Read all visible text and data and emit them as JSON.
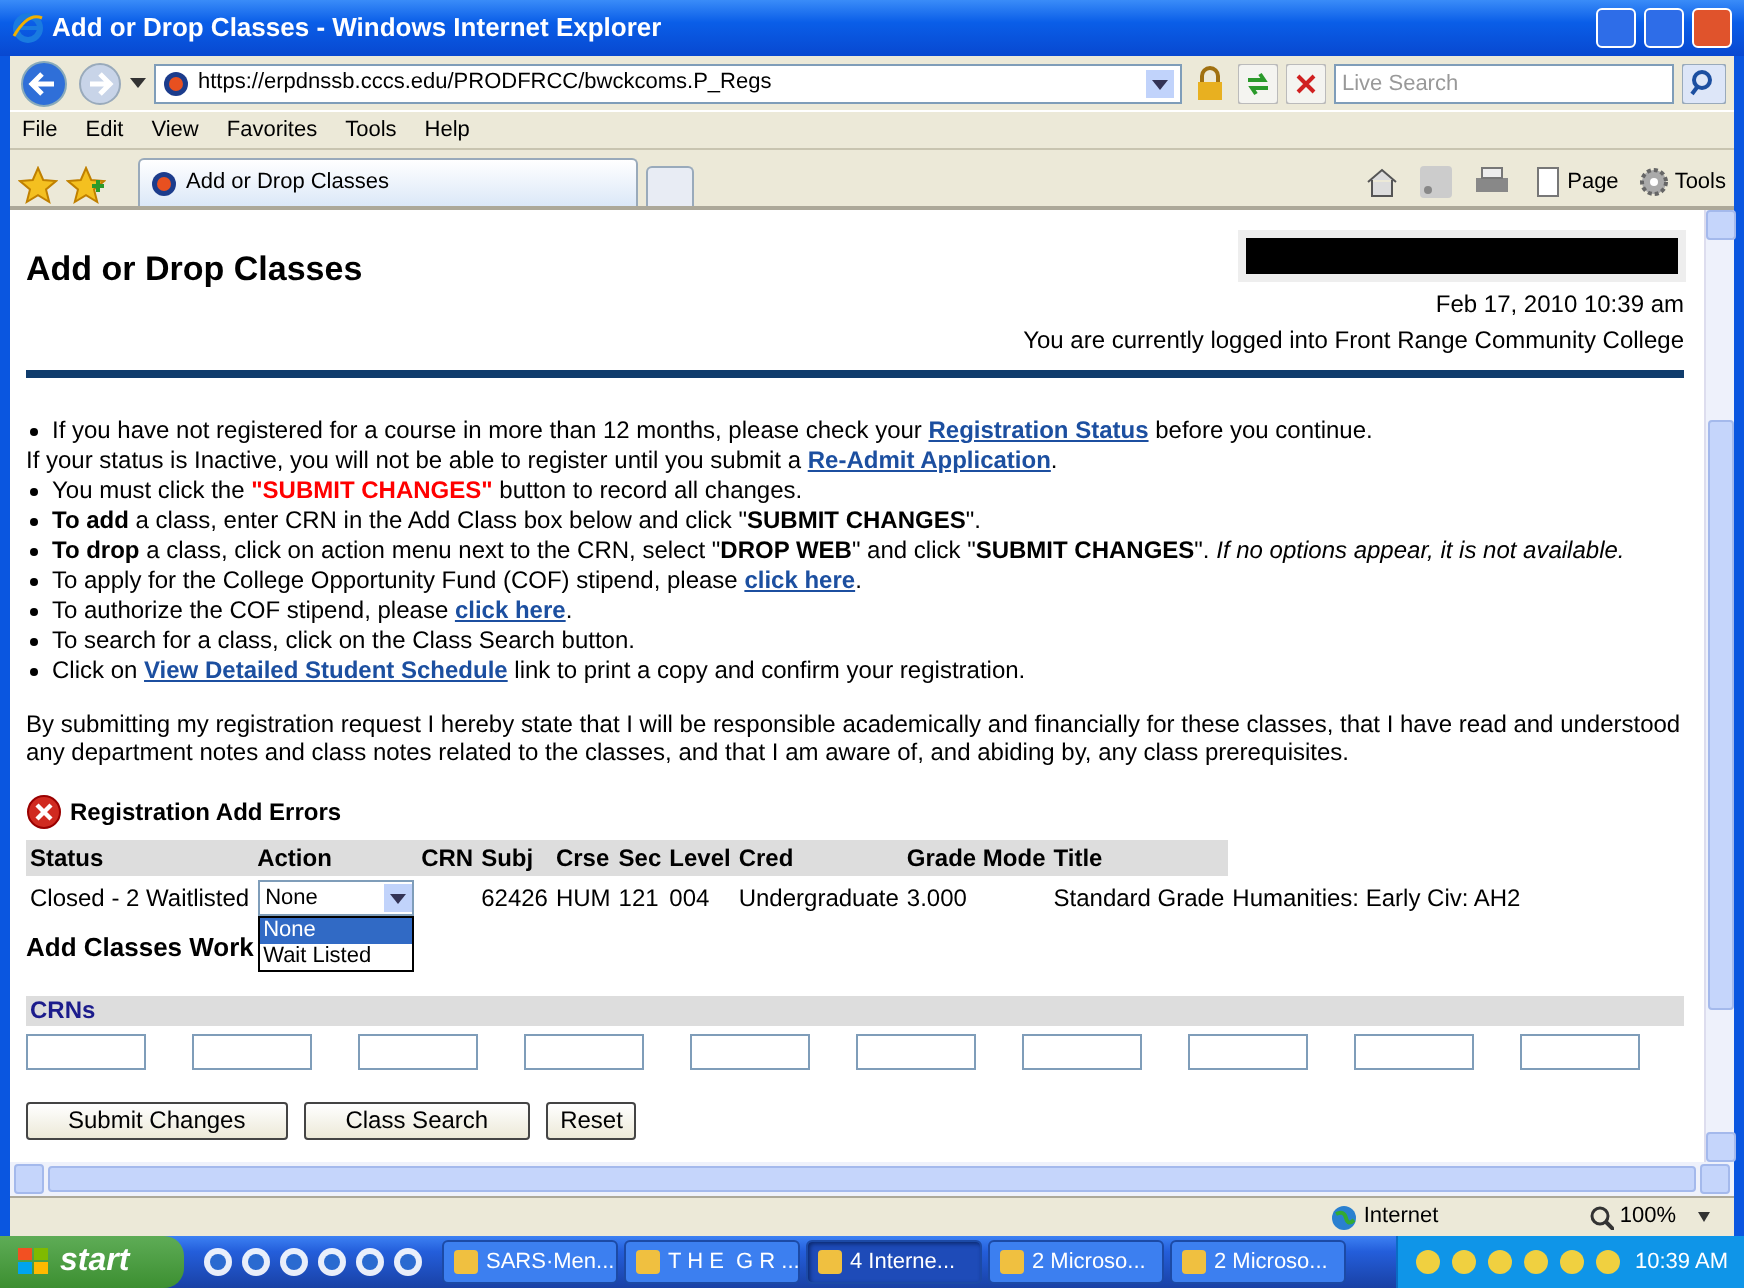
{
  "window": {
    "title": "Add or Drop Classes - Windows Internet Explorer"
  },
  "address_bar": {
    "url": "https://erpdnssb.cccs.edu/PRODFRCC/bwckcoms.P_Regs",
    "search_placeholder": "Live Search"
  },
  "menu": [
    "File",
    "Edit",
    "View",
    "Favorites",
    "Tools",
    "Help"
  ],
  "tab": {
    "label": "Add or Drop Classes"
  },
  "command_bar": [
    "Page",
    "Tools"
  ],
  "page": {
    "title": "Add or Drop Classes",
    "date": "Feb 17, 2010 10:39 am",
    "login": "You are currently logged into Front Range Community College",
    "instructions": [
      {
        "bullet": true,
        "parts": [
          {
            "kind": "text",
            "text": "If you have not registered for a course in more than 12 months, please check your "
          },
          {
            "kind": "link",
            "text": "Registration Status"
          },
          {
            "kind": "text",
            "text": " before you continue."
          }
        ]
      },
      {
        "bullet": false,
        "parts": [
          {
            "kind": "text",
            "text": "If your status is Inactive, you will not be able to register until you submit a "
          },
          {
            "kind": "link",
            "text": "Re-Admit Application"
          },
          {
            "kind": "text",
            "text": "."
          }
        ]
      },
      {
        "bullet": true,
        "parts": [
          {
            "kind": "text",
            "text": "You must click the "
          },
          {
            "kind": "alert",
            "text": "\"SUBMIT CHANGES\""
          },
          {
            "kind": "text",
            "text": " button to record all changes."
          }
        ]
      },
      {
        "bullet": true,
        "parts": [
          {
            "kind": "text",
            "text": "**To add** a class, enter CRN in the Add Class box below and click \"**SUBMIT CHANGES**\"."
          }
        ]
      },
      {
        "bullet": true,
        "parts": [
          {
            "kind": "text",
            "text": "**To drop** a class, click on action menu next to the CRN, select \"**DROP WEB**\" and click \"**SUBMIT CHANGES**\". *If no options appear, it is not available.*"
          }
        ]
      },
      {
        "bullet": true,
        "parts": [
          {
            "kind": "text",
            "text": "To apply for the College Opportunity Fund (COF) stipend, please "
          },
          {
            "kind": "link",
            "text": "click here"
          },
          {
            "kind": "text",
            "text": "."
          }
        ]
      },
      {
        "bullet": true,
        "parts": [
          {
            "kind": "text",
            "text": "To authorize the COF stipend, please "
          },
          {
            "kind": "link",
            "text": "click here"
          },
          {
            "kind": "text",
            "text": "."
          }
        ]
      },
      {
        "bullet": true,
        "parts": [
          {
            "kind": "text",
            "text": "To search for a class, click on the Class Search button."
          }
        ]
      },
      {
        "bullet": true,
        "parts": [
          {
            "kind": "text",
            "text": "Click on "
          },
          {
            "kind": "link",
            "text": "View Detailed Student Schedule"
          },
          {
            "kind": "text",
            "text": " link to print a copy and confirm your registration."
          }
        ]
      }
    ],
    "statement": "By submitting my registration request I hereby state that I will be responsible academically and financially for these classes, that I have read and understood any department notes and class notes related to the classes, and that I am aware of, and abiding by, any class prerequisites.",
    "errors": {
      "title": "Registration Add Errors",
      "columns": [
        "Status",
        "Action",
        "CRN",
        "Subj",
        "Crse",
        "Sec",
        "Level",
        "Cred",
        "Grade Mode",
        "Title"
      ],
      "rows": [
        {
          "status": "Closed - 2 Waitlisted",
          "action": {
            "value": "None",
            "expanded": true,
            "options": [
              {
                "label": "None",
                "selected": true
              },
              {
                "label": "Wait Listed",
                "selected": false
              }
            ]
          },
          "crn": "62426",
          "subj": "HUM",
          "crse": "121",
          "sec": "004",
          "level": "Undergraduate",
          "cred": "3.000",
          "grade_mode": "Standard Grade",
          "title": "Humanities: Early Civ: AH2"
        }
      ]
    },
    "worksheet": {
      "title": "Add Classes Work",
      "label": "CRNs",
      "crn_fields": [
        {
          "kind": "input"
        },
        {
          "kind": "input"
        },
        {
          "kind": "input"
        },
        {
          "kind": "input"
        },
        {
          "kind": "input"
        },
        {
          "kind": "input"
        },
        {
          "kind": "input"
        },
        {
          "kind": "input"
        },
        {
          "kind": "input"
        },
        {
          "kind": "input"
        }
      ]
    },
    "buttons": [
      "Submit Changes",
      "Class Search",
      "Reset"
    ]
  },
  "status_bar": {
    "zone": "Internet",
    "zoom": "100%"
  },
  "taskbar": {
    "start": "start",
    "tasks": [
      {
        "label": "SARS·Men...",
        "selected": false
      },
      {
        "label": "T H E  G R ...",
        "selected": false
      },
      {
        "label": "4 Interne...",
        "selected": true
      },
      {
        "label": "2 Microso...",
        "selected": false
      },
      {
        "label": "2 Microso...",
        "selected": false
      }
    ],
    "clock": "10:39 AM"
  }
}
